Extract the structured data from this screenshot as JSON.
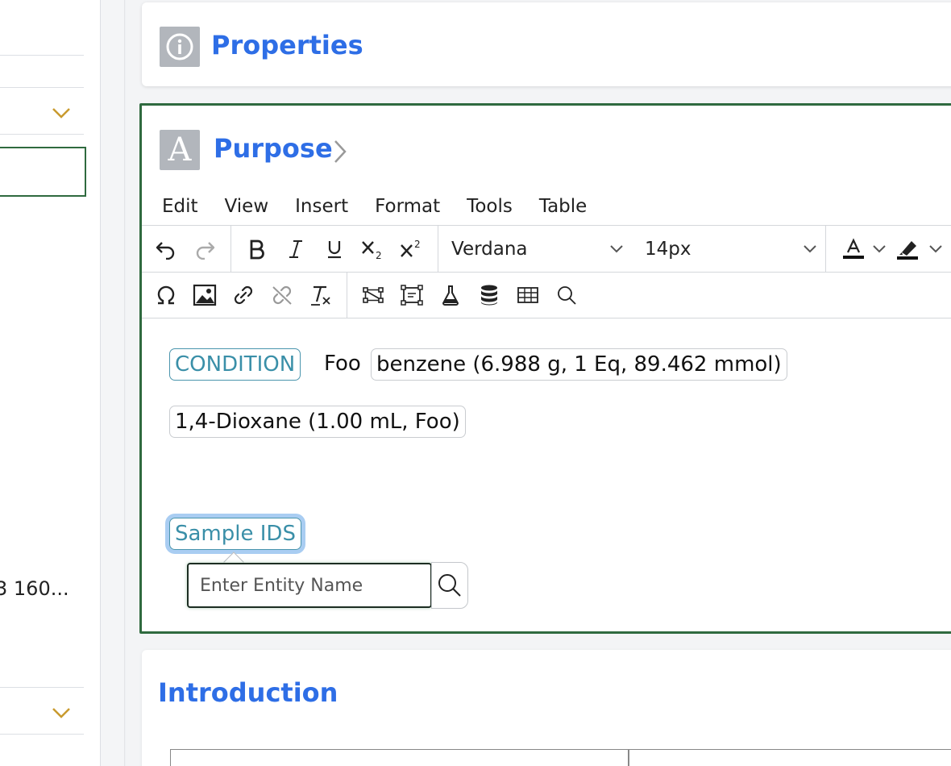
{
  "sidebar": {
    "truncated_text": "3 160..."
  },
  "properties": {
    "title": "Properties",
    "icon": "info-icon"
  },
  "purpose": {
    "title": "Purpose",
    "icon_letter": "A",
    "menu": [
      "Edit",
      "View",
      "Insert",
      "Format",
      "Tools",
      "Table"
    ],
    "font_family": "Verdana",
    "font_size": "14px",
    "text_color_glyph": "A",
    "content": {
      "condition_tag": "CONDITION",
      "foo_text": "Foo",
      "reagent_chip": "benzene (6.988 g, 1 Eq, 89.462 mmol)",
      "solvent_chip": "1,4-Dioxane (1.00 mL, Foo)",
      "sample_tag": "Sample IDS"
    },
    "entity_search": {
      "placeholder": "Enter Entity Name"
    }
  },
  "introduction": {
    "title": "Introduction"
  },
  "colors": {
    "accent_blue": "#2e6ee6",
    "active_border_green": "#2f6a3f",
    "tag_teal": "#3a8fa8",
    "chevron_gold": "#c99a2e"
  }
}
